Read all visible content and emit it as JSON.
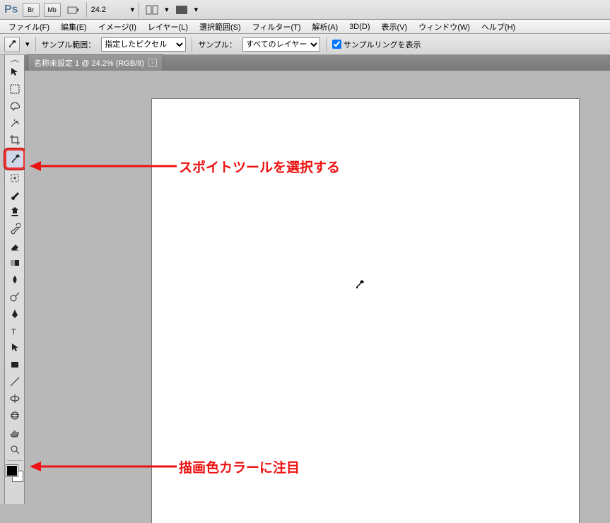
{
  "app": {
    "logo": "Ps"
  },
  "top": {
    "br": "Br",
    "mb": "Mb",
    "zoom_value": "24.2"
  },
  "menu": {
    "items": [
      "ファイル(F)",
      "編集(E)",
      "イメージ(I)",
      "レイヤー(L)",
      "選択範囲(S)",
      "フィルター(T)",
      "解析(A)",
      "3D(D)",
      "表示(V)",
      "ウィンドウ(W)",
      "ヘルプ(H)"
    ]
  },
  "options": {
    "sample_range_label": "サンプル範囲：",
    "sample_range_value": "指定したピクセル",
    "sample_label": "サンプル：",
    "sample_value": "すべてのレイヤー",
    "show_ring_label": "サンプルリングを表示"
  },
  "doc": {
    "tab_title": "名称未設定 1 @ 24.2% (RGB/8)"
  },
  "colors": {
    "foreground": "#000000",
    "background": "#ffffff"
  },
  "annotations": {
    "a1": "スポイトツールを選択する",
    "a2": "描画色カラーに注目"
  },
  "tools": {
    "list": [
      "move",
      "marquee",
      "lasso",
      "wand",
      "crop",
      "eyedropper",
      "healing",
      "brush",
      "stamp",
      "history-brush",
      "eraser",
      "gradient",
      "blur",
      "dodge",
      "pen",
      "type",
      "path-select",
      "rect-shape",
      "line-shape",
      "3d-rotate",
      "3d-orbit",
      "hand",
      "zoom"
    ],
    "selected": "eyedropper"
  }
}
